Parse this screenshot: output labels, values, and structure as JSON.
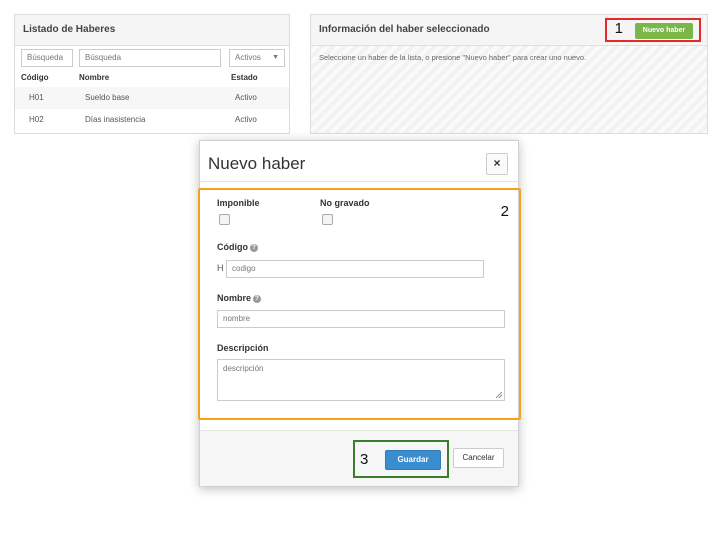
{
  "left_panel": {
    "title": "Listado de Haberes",
    "search_code_placeholder": "Búsqueda",
    "search_name_placeholder": "Búsqueda",
    "status_filter": "Activos",
    "columns": [
      "Código",
      "Nombre",
      "Estado"
    ],
    "rows": [
      {
        "code": "H01",
        "name": "Sueldo base",
        "status": "Activo"
      },
      {
        "code": "H02",
        "name": "Días inasistencia",
        "status": "Activo"
      }
    ]
  },
  "right_panel": {
    "title": "Información del haber seleccionado",
    "info": "Seleccione un haber de la lista, o presione \"Nuevo haber\" para crear uno nuevo.",
    "new_button": "Nuevo haber"
  },
  "callouts": {
    "one": "1",
    "two": "2",
    "three": "3"
  },
  "modal": {
    "title": "Nuevo haber",
    "close_symbol": "×",
    "taxable_label": "Imponible",
    "not_taxed_label": "No gravado",
    "code_label": "Código",
    "code_prefix": "H",
    "code_placeholder": "codigo",
    "name_label": "Nombre",
    "name_placeholder": "nombre",
    "description_label": "Descripción",
    "description_placeholder": "descripción",
    "save_button": "Guardar",
    "cancel_button": "Cancelar"
  },
  "colors": {
    "callout_red": "#e32a2a",
    "callout_orange": "#f5a11e",
    "callout_green": "#3a7d2c",
    "new_button": "#7ab648",
    "save_button": "#3a8ed0"
  },
  "icons": {
    "help": "help-circle-icon",
    "close": "close-icon",
    "dropdown": "caret-down-icon"
  }
}
